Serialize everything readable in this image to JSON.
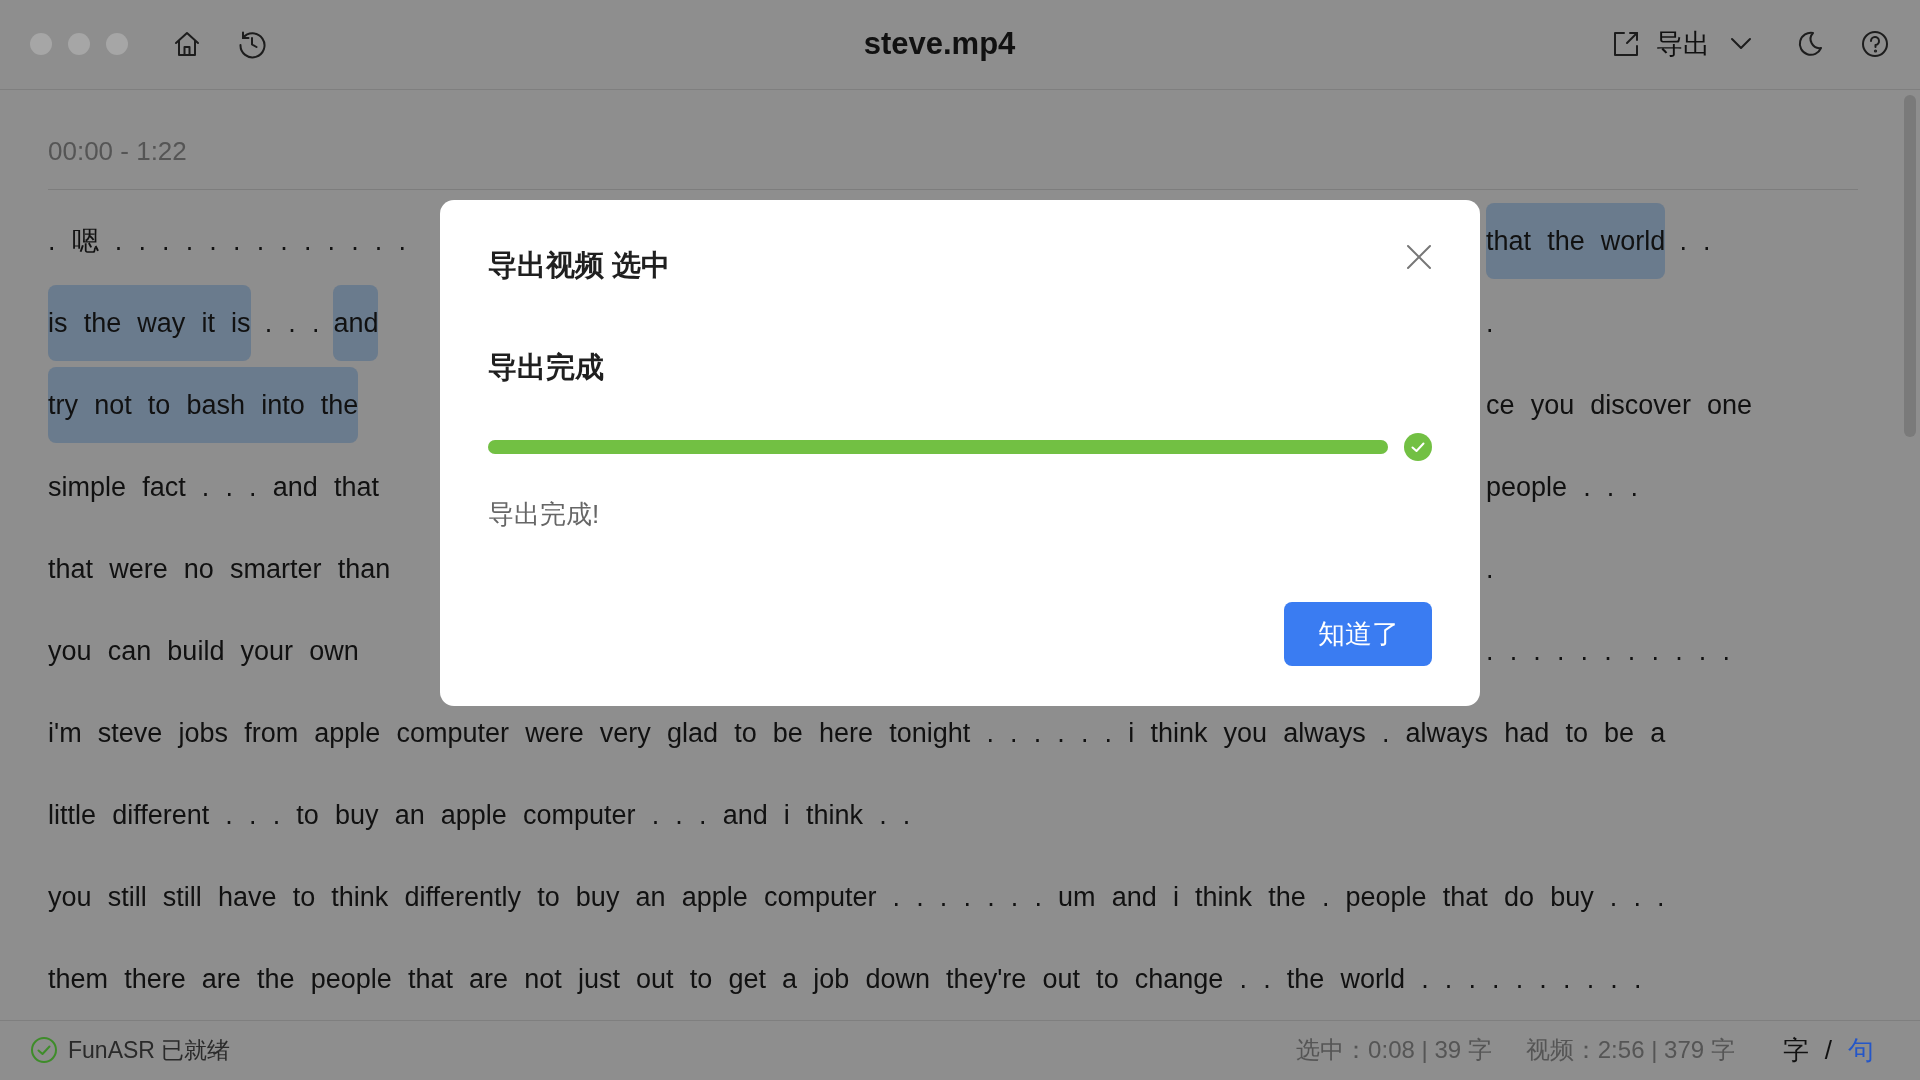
{
  "window": {
    "title": "steve.mp4"
  },
  "toolbar": {
    "export_label": "导出"
  },
  "transcript": {
    "time_range": "00:00 - 1:22",
    "lines": [
      {
        "left": [
          {
            "text": ". 嗯 . . . . . . . . . . . . .",
            "selected": false
          }
        ],
        "right": [
          {
            "text": "that the world",
            "selected": true
          },
          {
            "text": ". .",
            "selected": false
          }
        ]
      },
      {
        "left": [
          {
            "text": "is the way it is",
            "selected": true
          },
          {
            "text": ". . .",
            "selected": false
          },
          {
            "text": "and",
            "selected": true
          }
        ],
        "right": [
          {
            "text": ".",
            "selected": false
          }
        ]
      },
      {
        "left": [
          {
            "text": "try not to bash into the",
            "selected": true
          }
        ],
        "right": [
          {
            "text": "ce you discover one",
            "selected": false
          }
        ]
      },
      {
        "left": [
          {
            "text": "simple fact . . . and that",
            "selected": false
          }
        ],
        "right": [
          {
            "text": "people . . .",
            "selected": false
          }
        ]
      },
      {
        "left": [
          {
            "text": "that were no smarter than",
            "selected": false
          }
        ],
        "right": [
          {
            "text": ".",
            "selected": false
          }
        ]
      },
      {
        "left": [
          {
            "text": "you can build your own",
            "selected": false
          }
        ],
        "right": [
          {
            "text": ". . . . . . . . . . .",
            "selected": false
          }
        ]
      },
      {
        "full": [
          {
            "text": "i'm steve jobs from apple computer were very glad to be here tonight . . . . . . i think you always . always had to be a",
            "selected": false
          }
        ]
      },
      {
        "full": [
          {
            "text": "little different . . . to buy an apple computer . . . and i think . .",
            "selected": false
          }
        ]
      },
      {
        "full": [
          {
            "text": "you still still have to think differently to buy an apple computer . . . . . . . um and i think the . people that do buy . . .",
            "selected": false
          }
        ]
      },
      {
        "full": [
          {
            "text": "them there are the people that are not just out to get a job down they're out to change . . the world . . . . . . . . . .",
            "selected": false
          }
        ]
      }
    ]
  },
  "dialog": {
    "title": "导出视频 选中",
    "heading": "导出完成",
    "progress": {
      "level": 1.0
    },
    "message": "导出完成!",
    "button": "知道了"
  },
  "status_bar": {
    "engine": "FunASR 已就绪",
    "selection": "选中：0:08 | 39 字",
    "video": "视频：2:56 | 379 字",
    "modes": [
      {
        "label": "字",
        "selected": false
      },
      {
        "label": "句",
        "selected": true
      }
    ],
    "separator": "/"
  }
}
